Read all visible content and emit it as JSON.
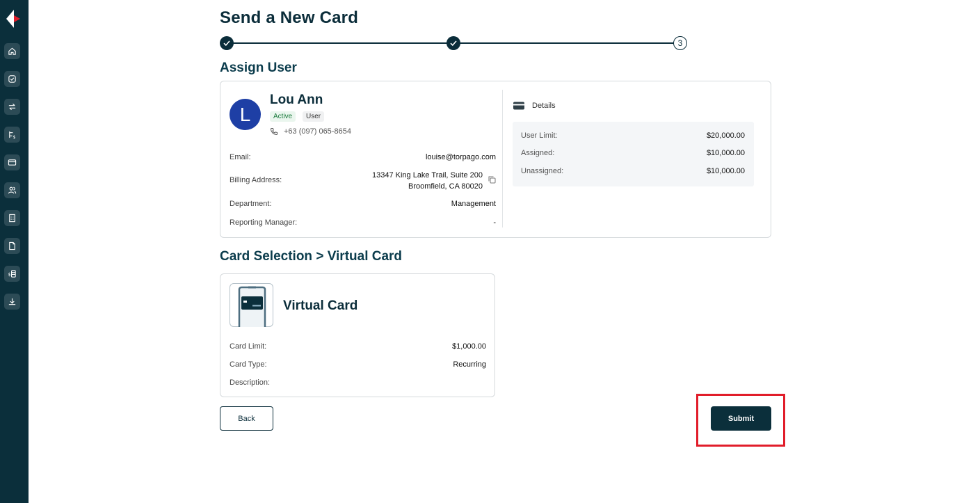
{
  "page": {
    "title": "Send a New Card"
  },
  "stepper": {
    "step3_label": "3"
  },
  "assign_user": {
    "section_title": "Assign User",
    "avatar_initial": "L",
    "name": "Lou Ann",
    "status_badge": "Active",
    "role_badge": "User",
    "phone": "+63 (097) 065-8654",
    "fields": [
      {
        "label": "Email:",
        "value": "louise@torpago.com"
      },
      {
        "label": "Billing Address:",
        "value_line1": "13347 King Lake Trail, Suite 200",
        "value_line2": "Broomfield, CA 80020"
      },
      {
        "label": "Department:",
        "value": "Management"
      },
      {
        "label": "Reporting Manager:",
        "value": "-"
      }
    ],
    "details": {
      "heading": "Details",
      "rows": [
        {
          "label": "User Limit:",
          "value": "$20,000.00"
        },
        {
          "label": "Assigned:",
          "value": "$10,000.00"
        },
        {
          "label": "Unassigned:",
          "value": "$10,000.00"
        }
      ]
    }
  },
  "card_selection": {
    "section_title": "Card Selection > Virtual Card",
    "card_title": "Virtual Card",
    "rows": [
      {
        "label": "Card Limit:",
        "value": "$1,000.00"
      },
      {
        "label": "Card Type:",
        "value": "Recurring"
      },
      {
        "label": "Description:",
        "value": ""
      }
    ]
  },
  "actions": {
    "back_label": "Back",
    "submit_label": "Submit"
  },
  "sidebar": {
    "items": [
      "home-icon",
      "check-circle-icon",
      "transfer-icon",
      "payment-routing-icon",
      "card-icon",
      "users-icon",
      "building-icon",
      "document-icon",
      "cash-icon",
      "download-icon"
    ]
  },
  "colors": {
    "sidebar": "#0b2f3b",
    "primary": "#0b2d3a",
    "avatar": "#1e3fa5",
    "highlight": "#e11d2a"
  }
}
